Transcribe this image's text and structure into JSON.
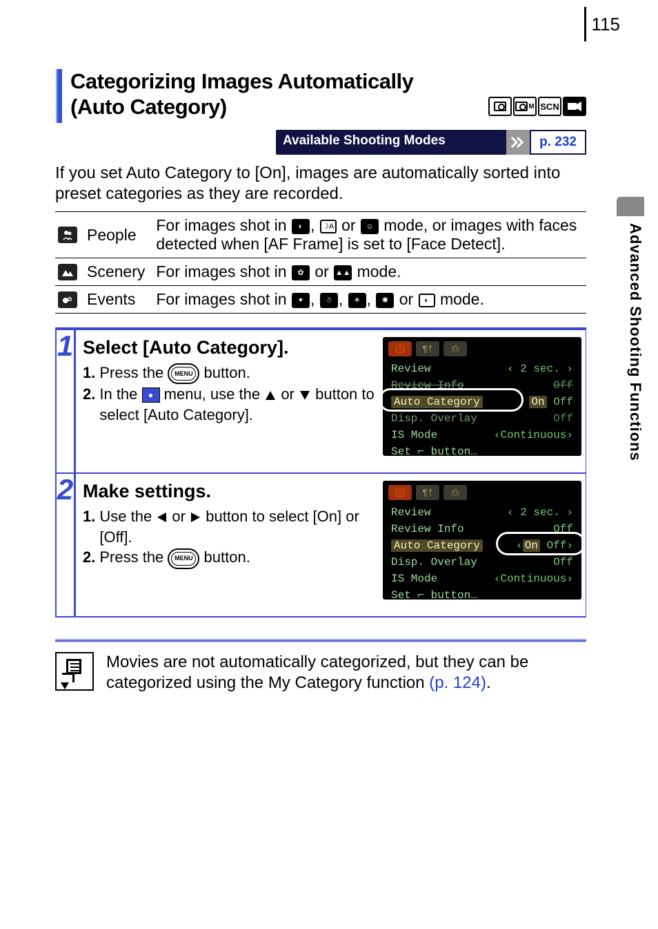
{
  "page_number": "115",
  "side_tab": "Advanced Shooting Functions",
  "title_line1": "Categorizing Images Automatically",
  "title_line2": "(Auto Category)",
  "mode_strip": [
    "camera-icon",
    "camera-m-icon",
    "SCN",
    "movie-icon"
  ],
  "asm": {
    "label": "Available Shooting Modes",
    "ref": "p. 232"
  },
  "intro": "If you set Auto Category to [On], images are automatically sorted into preset categories as they are recorded.",
  "cat_table": [
    {
      "icon": "people-icon",
      "label": "People",
      "desc_pre": "For images shot in ",
      "desc_mid": " mode, or images with faces detected when [AF Frame] is set to [Face Detect]."
    },
    {
      "icon": "scenery-icon",
      "label": "Scenery",
      "desc_pre": "For images shot in ",
      "desc_mid": " mode."
    },
    {
      "icon": "events-icon",
      "label": "Events",
      "desc_pre": "For images shot in ",
      "desc_mid": " mode."
    }
  ],
  "step1": {
    "num": "1",
    "title": "Select [Auto Category].",
    "s1_num": "1.",
    "s1_a": "Press the ",
    "s1_b": " button.",
    "s2_num": "2.",
    "s2_a": "In the ",
    "s2_b": " menu, use the ",
    "s2_c": " or ",
    "s2_d": " button to select [Auto Category]."
  },
  "step2": {
    "num": "2",
    "title": "Make settings.",
    "s1_num": "1.",
    "s1_a": "Use the ",
    "s1_b": " or ",
    "s1_c": " button to select [On] or [Off].",
    "s2_num": "2.",
    "s2_a": "Press the ",
    "s2_b": " button."
  },
  "menu_btn": "MENU",
  "lcd": {
    "rows": [
      {
        "k": "Review",
        "v": "2 sec."
      },
      {
        "k": "Review Info",
        "v": "Off"
      },
      {
        "k": "Auto Category",
        "v_on": "On",
        "v_off": "Off"
      },
      {
        "k": "Disp. Overlay",
        "v": "Off"
      },
      {
        "k": "IS Mode",
        "v": "Continuous"
      },
      {
        "k": "Set ⌐ button…",
        "v": ""
      }
    ]
  },
  "note": {
    "text_a": "Movies are not automatically categorized, but they can be categorized using the My Category function ",
    "ref": "(p. 124)",
    "text_b": "."
  }
}
